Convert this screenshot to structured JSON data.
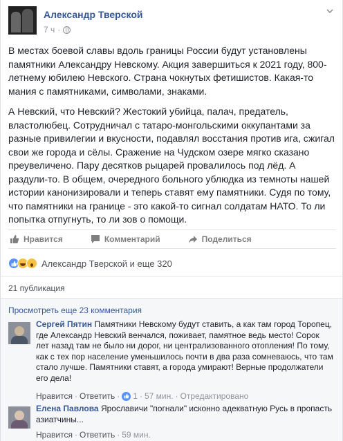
{
  "post": {
    "author": "Александр Тверской",
    "time": "7 ч",
    "dot": "·",
    "paragraphs": [
      "В местах боевой славы вдоль границы России будут установлены памятники Александру Невскому. Акция завершиться к 2021 году, 800-летнему юбилею Невского. Страна чокнутых фетишистов. Какая-то мания с памятниками, символами, знаками.",
      "А Невский, что Невский? Жестокий убийца, палач, предатель, властолюбец. Сотрудничал с татаро-монгольскими оккупантами за разные привилегии и вкусности, подавлял восстания против ига, сжигал свои же города и сёлы. Сражение на Чудском озере мягко сказано преувеличено. Пару десятков рыцарей провалилось под лёд. А раздули-то. В общем, очередного больного ублюдка из темноты нашей истории канонизировали и теперь ставят ему памятники. Судя по тому, что памятники на границе - это какой-то сигнал солдатам НАТО. То ли попытка отпугнуть, то ли зов о помощи."
    ]
  },
  "actions": {
    "like": "Нравится",
    "comment": "Комментарий",
    "share": "Поделиться"
  },
  "reactions": {
    "summary": "Александр Тверской и еще 320"
  },
  "shares": "21 публикация",
  "comments": {
    "view_more": "Просмотреть еще 23 комментария",
    "items": [
      {
        "name": "Сергей Пятин",
        "text": "Памятники Невскому будут ставить, а как там город Торопец, где Александр Невский венчался, поживает, памятное ведь место! Сорок лет назад там не было ни дорог, ни централизованного отопления! По тому, как с тех пор население уменьшилось почти в два раза сомневаюсь, что там стало лучше. Памятники ставят, а города умирают! Верные продолжатели его дела!",
        "like": "Нравится",
        "reply": "Ответить",
        "likes": "1",
        "time": "57 мин.",
        "edited": "Отредактировано"
      },
      {
        "name": "Елена Павлова",
        "text": "Ярославичи \"погнали\" исконно адекватную Русь в пропасть азиатчины...",
        "like": "Нравится",
        "reply": "Ответить",
        "time": "59 мин."
      }
    ]
  }
}
